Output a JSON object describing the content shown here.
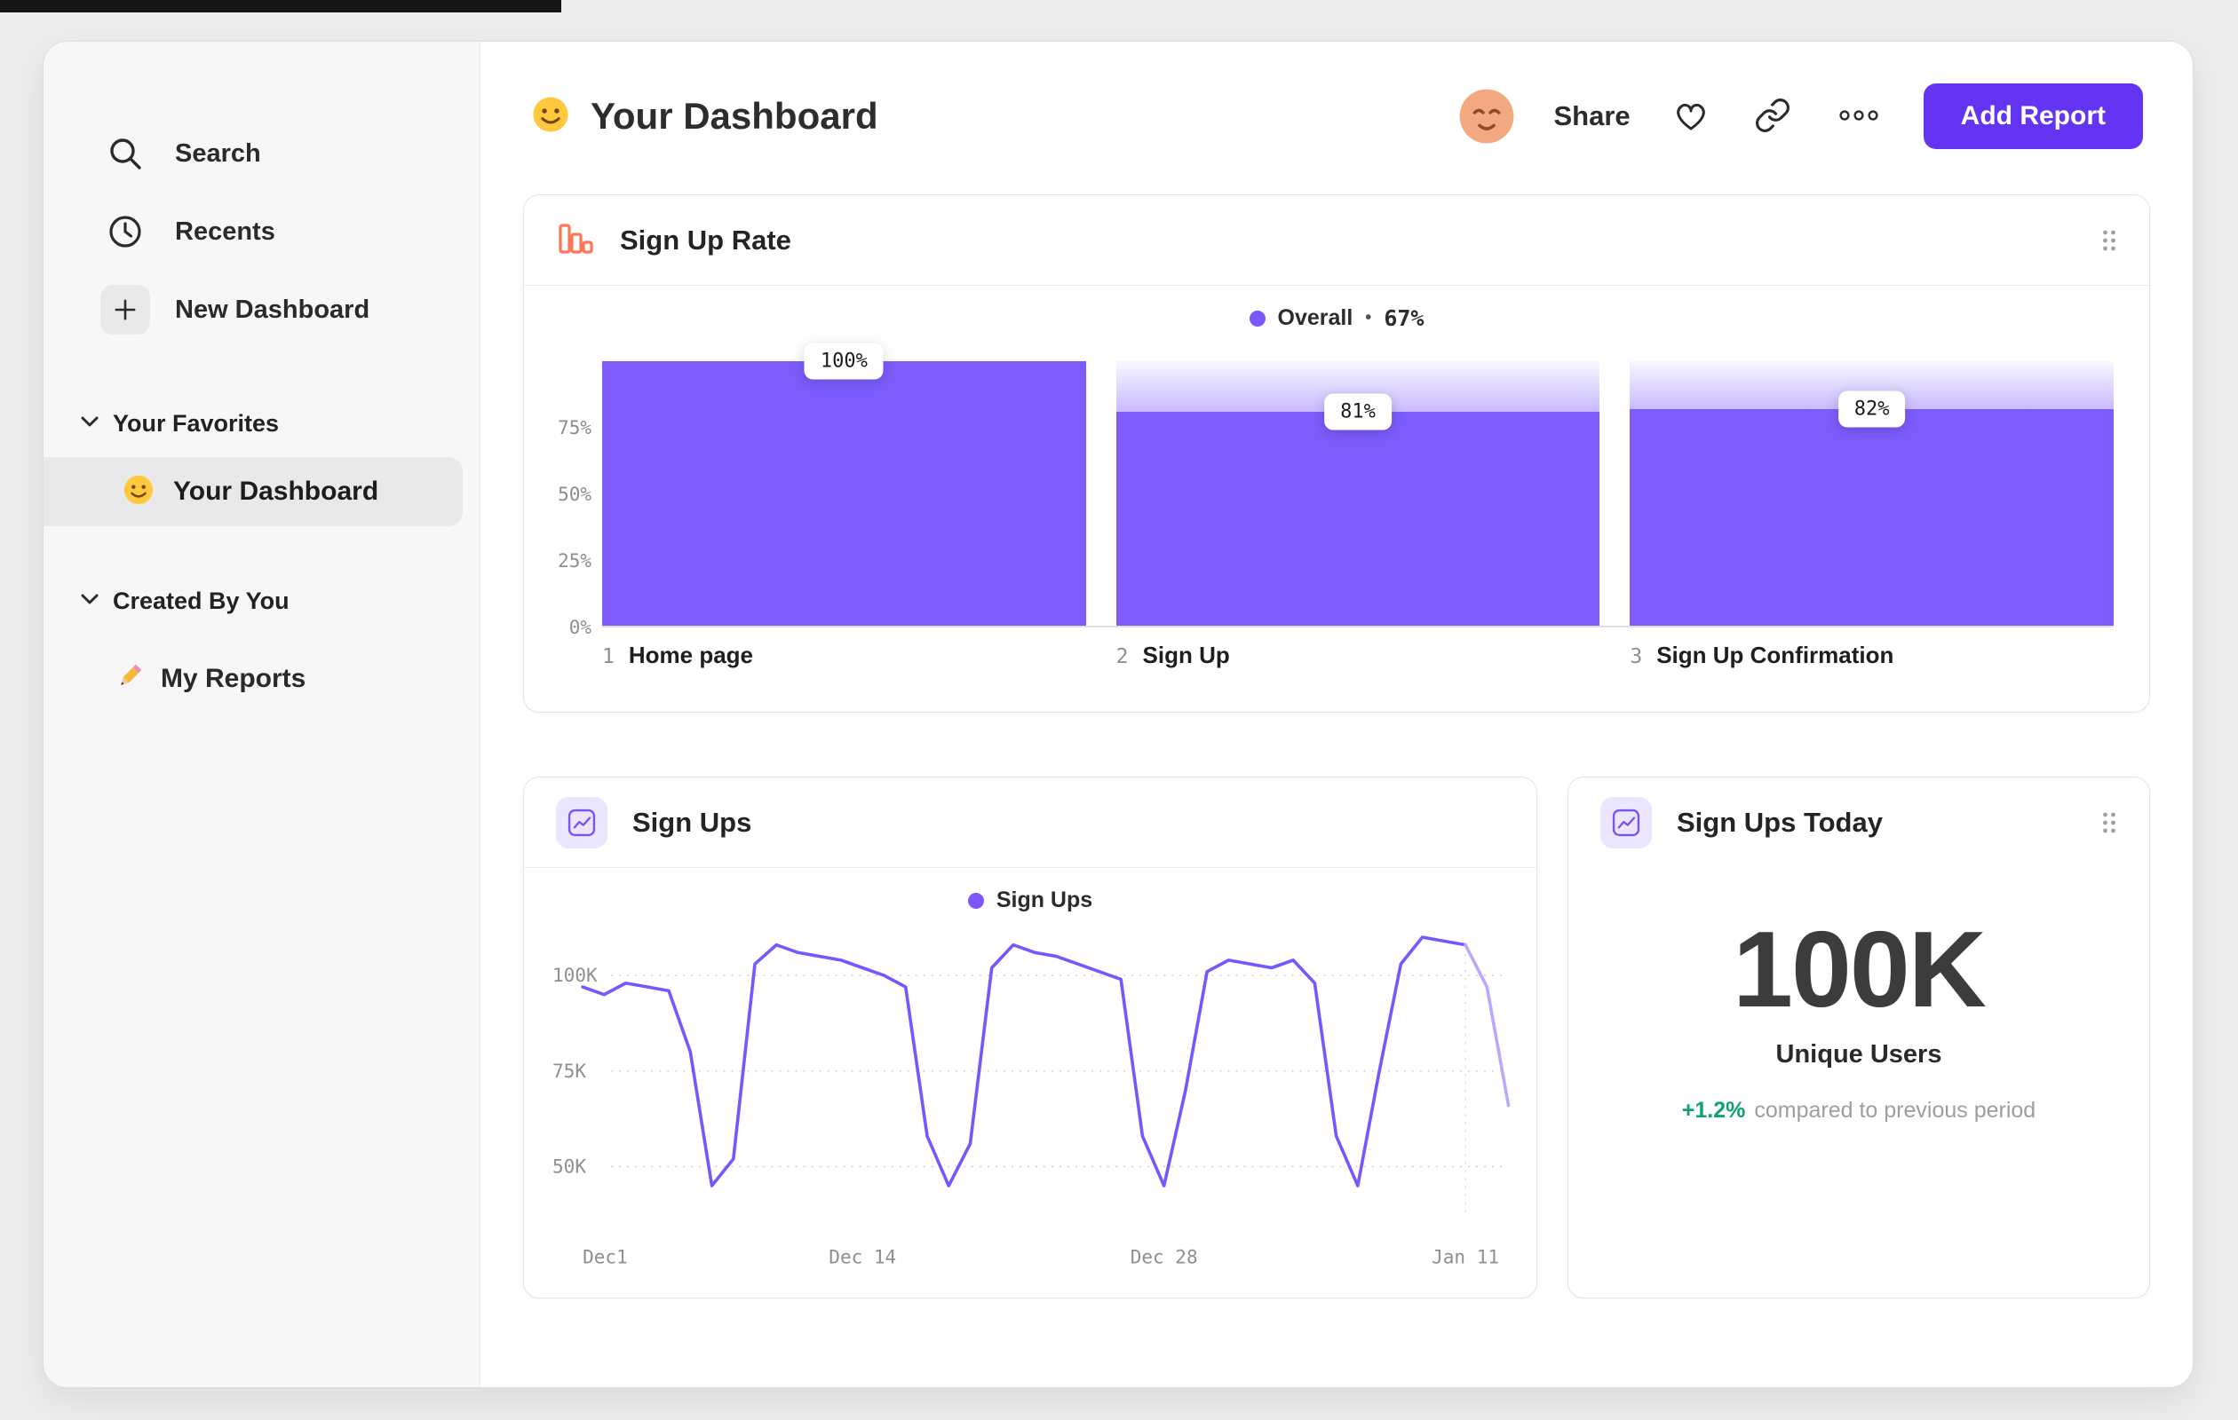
{
  "sidebar": {
    "items": [
      {
        "label": "Search",
        "icon": "search-icon"
      },
      {
        "label": "Recents",
        "icon": "clock-icon"
      },
      {
        "label": "New Dashboard",
        "icon": "plus-icon"
      }
    ],
    "sections": [
      {
        "label": "Your Favorites",
        "collapsed": false,
        "items": [
          {
            "label": "Your Dashboard",
            "icon": "smiley-face-icon",
            "selected": true
          }
        ]
      },
      {
        "label": "Created By You",
        "collapsed": false,
        "items": [
          {
            "label": "My Reports",
            "icon": "pencil-icon",
            "selected": false
          }
        ]
      }
    ]
  },
  "header": {
    "title_icon": "smiley-face-icon",
    "title": "Your Dashboard",
    "avatar_icon": "relieved-face-avatar",
    "share_label": "Share",
    "actions": [
      "favorite-heart",
      "copy-link",
      "more-options"
    ],
    "add_report_label": "Add Report",
    "accent_color": "#6335f2"
  },
  "chart_data": [
    {
      "type": "bar",
      "chart_kind": "funnel",
      "title": "Sign Up Rate",
      "legend_label": "Overall",
      "legend_separator": "•",
      "legend_value": "67%",
      "overall_rate_pct": 67,
      "categories": [
        "Home page",
        "Sign Up",
        "Sign Up Confirmation"
      ],
      "step_numbers": [
        "1",
        "2",
        "3"
      ],
      "values": [
        100,
        81,
        82
      ],
      "value_labels": [
        "100%",
        "81%",
        "82%"
      ],
      "unit": "%",
      "y_tick_labels": [
        "75%",
        "50%",
        "25%",
        "0%"
      ],
      "y_tick_values": [
        75,
        50,
        25,
        0
      ],
      "ylim": [
        0,
        100
      ],
      "bar_color": "#7c5cfc"
    },
    {
      "type": "line",
      "title": "Sign Ups",
      "legend_label": "Sign Ups",
      "x_tick_labels": [
        "Dec1",
        "Dec 14",
        "Dec 28",
        "Jan 11"
      ],
      "x_tick_days": [
        0,
        13,
        27,
        41
      ],
      "x_range_days": [
        0,
        43
      ],
      "values_k": [
        97,
        95,
        98,
        97,
        96,
        80,
        45,
        52,
        103,
        108,
        106,
        105,
        104,
        102,
        100,
        97,
        58,
        45,
        56,
        102,
        108,
        106,
        105,
        103,
        101,
        99,
        58,
        45,
        70,
        101,
        104,
        103,
        102,
        104,
        98,
        58,
        45,
        75,
        103,
        110,
        109,
        108,
        97,
        66
      ],
      "unit": "K",
      "y_tick_labels": [
        "100K",
        "75K",
        "50K"
      ],
      "y_tick_values": [
        100,
        75,
        50
      ],
      "ylim_k": [
        40,
        115
      ],
      "forecast_from_index": 41,
      "line_color": "#7856ff",
      "forecast_color": "#b9a9fb",
      "grid": "dotted-horizontal"
    },
    {
      "type": "metric",
      "title": "Sign Ups Today",
      "value": "100K",
      "label": "Unique Users",
      "change_pct": "+1.2%",
      "change_color": "#0fa36b",
      "comparison_note": "compared to previous period"
    }
  ]
}
